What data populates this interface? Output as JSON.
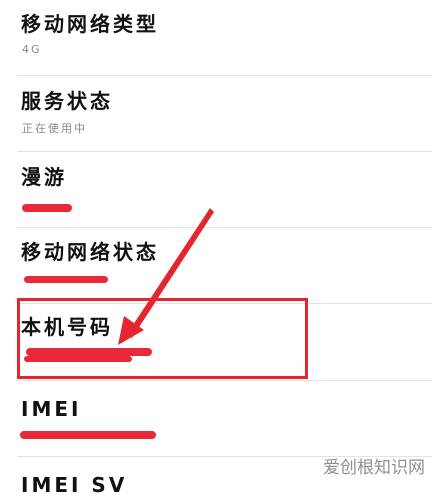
{
  "settings": {
    "items": [
      {
        "label": "移动网络类型",
        "value": "4G"
      },
      {
        "label": "服务状态",
        "value": "正在使用中"
      },
      {
        "label": "漫游",
        "value": ""
      },
      {
        "label": "移动网络状态",
        "value": ""
      },
      {
        "label": "本机号码",
        "value": ""
      },
      {
        "label": "IMEI",
        "value": ""
      },
      {
        "label": "IMEI SV",
        "value": ""
      }
    ]
  },
  "annotation": {
    "highlight_color": "#e3262f",
    "redaction_color": "#e8293a"
  },
  "watermark": {
    "text": "爱创根知识网"
  }
}
